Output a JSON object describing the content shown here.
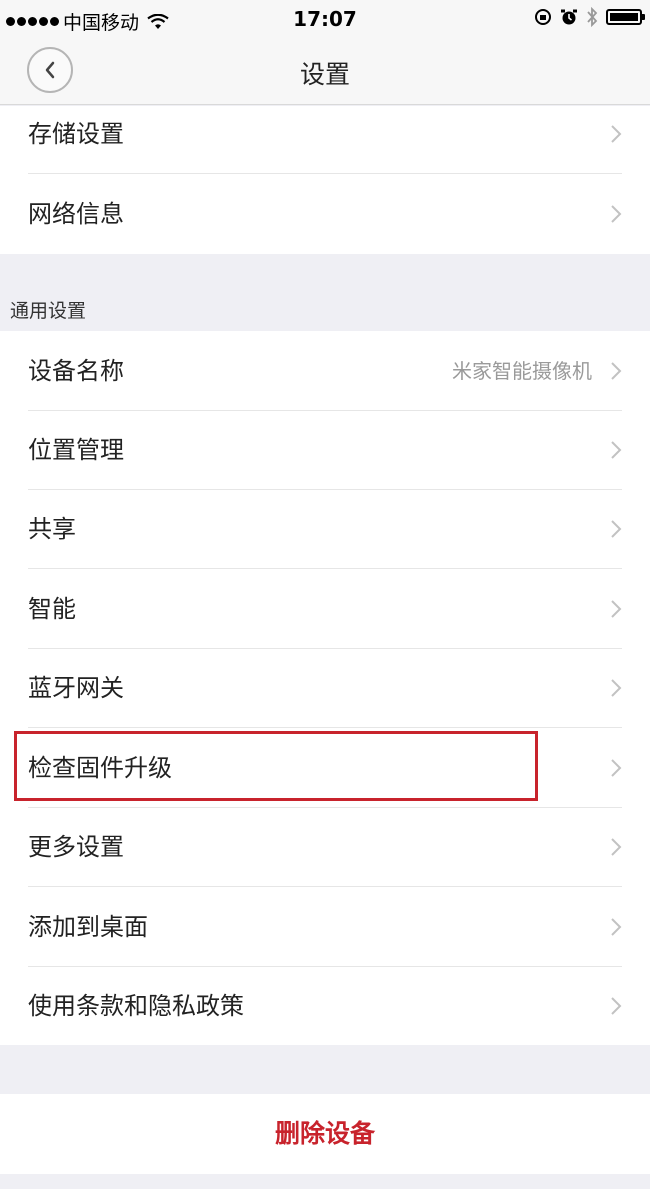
{
  "status_bar": {
    "carrier": "中国移动",
    "time": "17:07"
  },
  "nav": {
    "title": "设置"
  },
  "group_top": [
    {
      "label": "存储设置"
    },
    {
      "label": "网络信息"
    }
  ],
  "section_general": {
    "header": "通用设置",
    "items": [
      {
        "label": "设备名称",
        "value": "米家智能摄像机"
      },
      {
        "label": "位置管理"
      },
      {
        "label": "共享"
      },
      {
        "label": "智能"
      },
      {
        "label": "蓝牙网关"
      },
      {
        "label": "检查固件升级"
      },
      {
        "label": "更多设置"
      },
      {
        "label": "添加到桌面"
      },
      {
        "label": "使用条款和隐私政策"
      }
    ]
  },
  "delete_label": "删除设备",
  "colors": {
    "accent_red": "#c8232c",
    "background": "#efeff4"
  }
}
